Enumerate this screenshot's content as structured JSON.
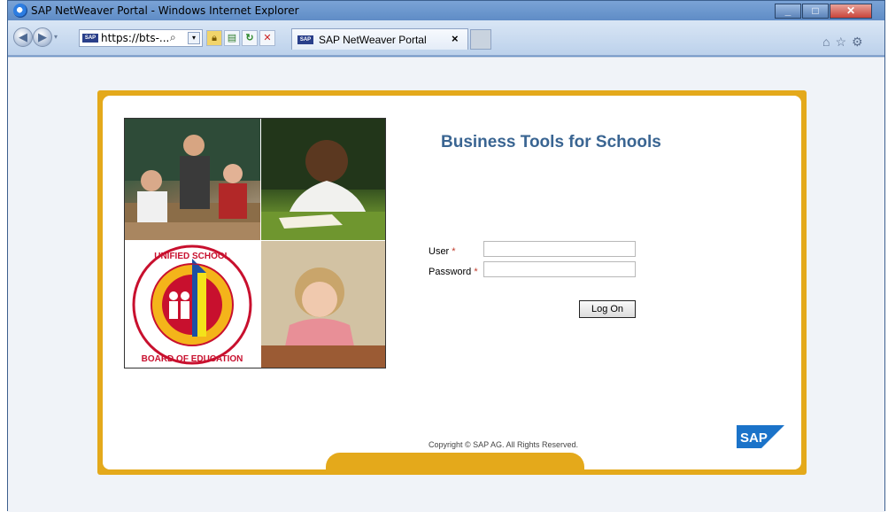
{
  "window": {
    "title": "SAP NetWeaver Portal - Windows Internet Explorer",
    "min_label": "_",
    "max_label": "□",
    "close_label": "✕"
  },
  "toolbar": {
    "address": "https://bts-...",
    "search_glyph": "⌕",
    "dropdown_glyph": "▾"
  },
  "tab": {
    "title": "SAP NetWeaver Portal",
    "close": "×"
  },
  "right_icons": {
    "home": "⌂",
    "favorites": "☆",
    "tools": "⚙"
  },
  "portal": {
    "heading": "Business Tools for Schools",
    "user_label": "User",
    "password_label": "Password",
    "required_marker": "*",
    "user_value": "",
    "password_value": "",
    "logon_label": "Log On",
    "copyright": "Copyright © SAP AG. All Rights Reserved.",
    "sap_logo_text": "SAP",
    "seal_text": "LOS ANGELES UNIFIED SCHOOL DISTRICT · BOARD OF EDUCATION"
  },
  "colors": {
    "accent_gold": "#e4a91b",
    "heading_blue": "#3a6592",
    "required_red": "#c03a2b",
    "sap_blue": "#1b73c9"
  }
}
